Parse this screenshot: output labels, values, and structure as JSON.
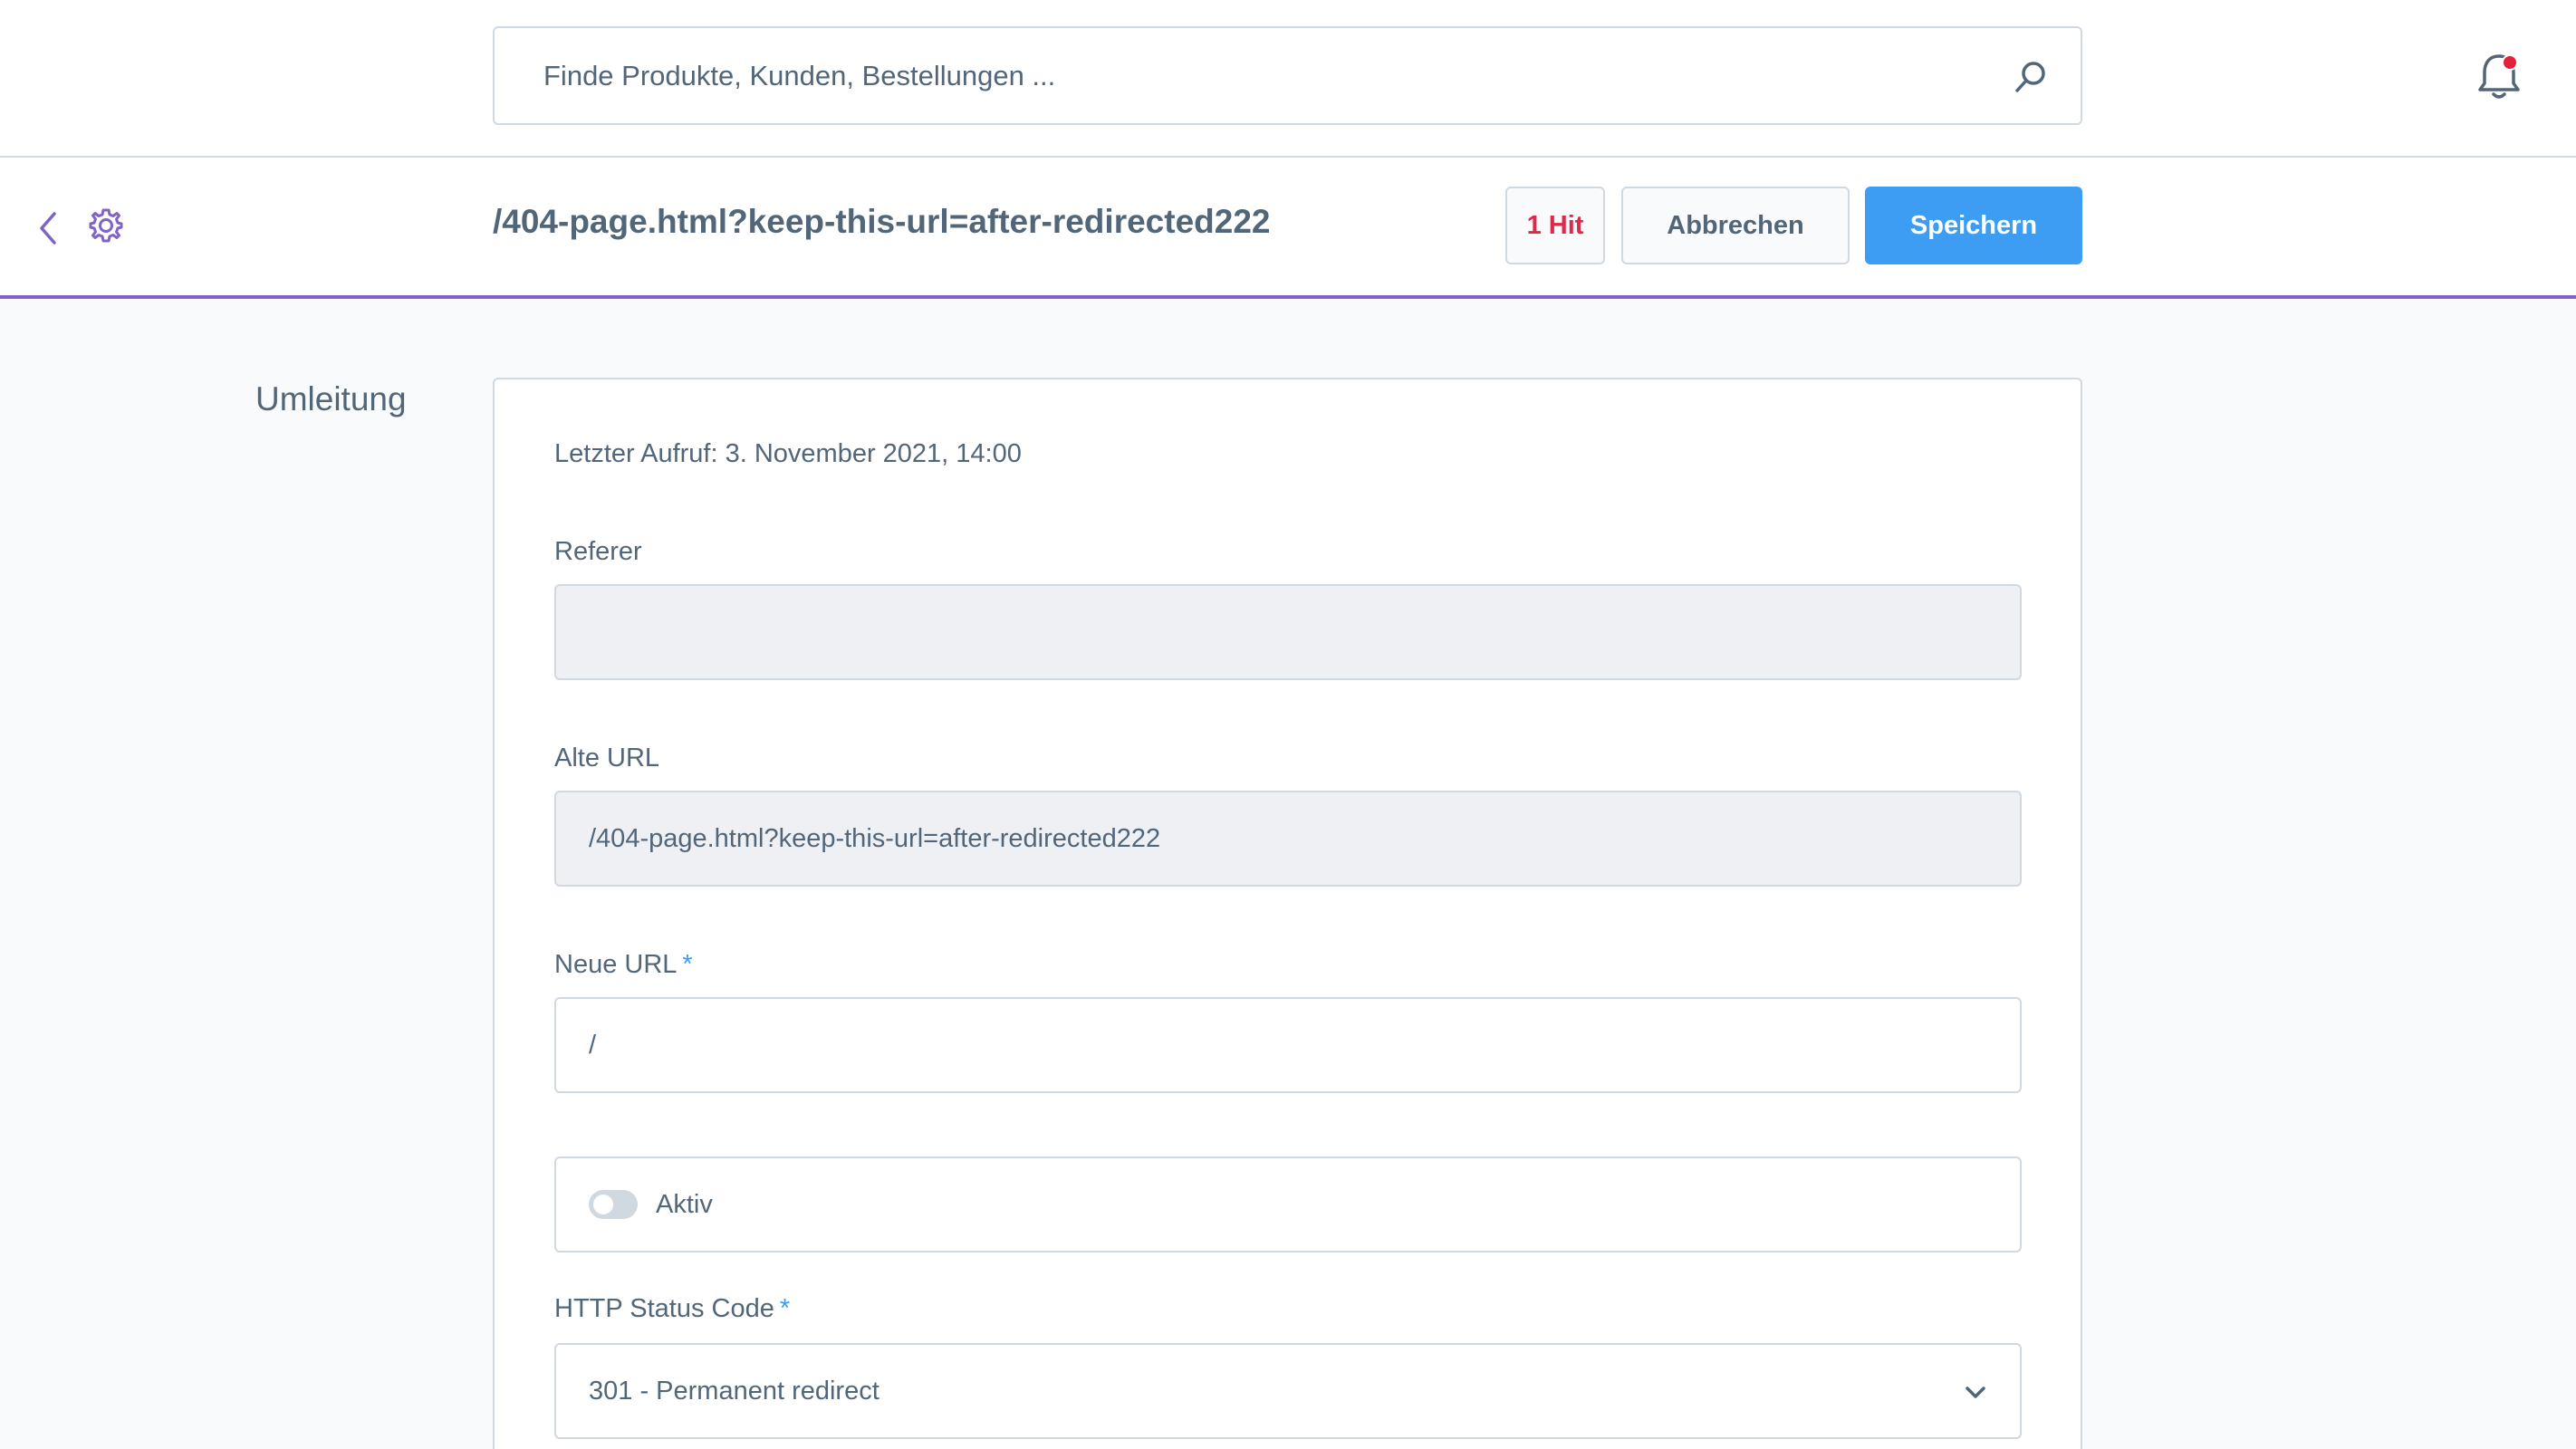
{
  "search": {
    "placeholder": "Finde Produkte, Kunden, Bestellungen ..."
  },
  "header": {
    "title": "/404-page.html?keep-this-url=after-redirected222",
    "hits": "1 Hit",
    "cancel_label": "Abbrechen",
    "save_label": "Speichern"
  },
  "section": {
    "label": "Umleitung"
  },
  "form": {
    "last_call": "Letzter Aufruf: 3. November 2021, 14:00",
    "referer": {
      "label": "Referer",
      "value": ""
    },
    "old_url": {
      "label": "Alte URL",
      "value": "/404-page.html?keep-this-url=after-redirected222"
    },
    "new_url": {
      "label": "Neue URL",
      "required_mark": "*",
      "value": "/"
    },
    "active": {
      "label": "Aktiv",
      "checked": false
    },
    "status_code": {
      "label": "HTTP Status Code",
      "required_mark": "*",
      "value": "301 - Permanent redirect"
    }
  },
  "colors": {
    "accent": "#7f63c7",
    "primary": "#3d9df3",
    "danger": "#de294c"
  }
}
